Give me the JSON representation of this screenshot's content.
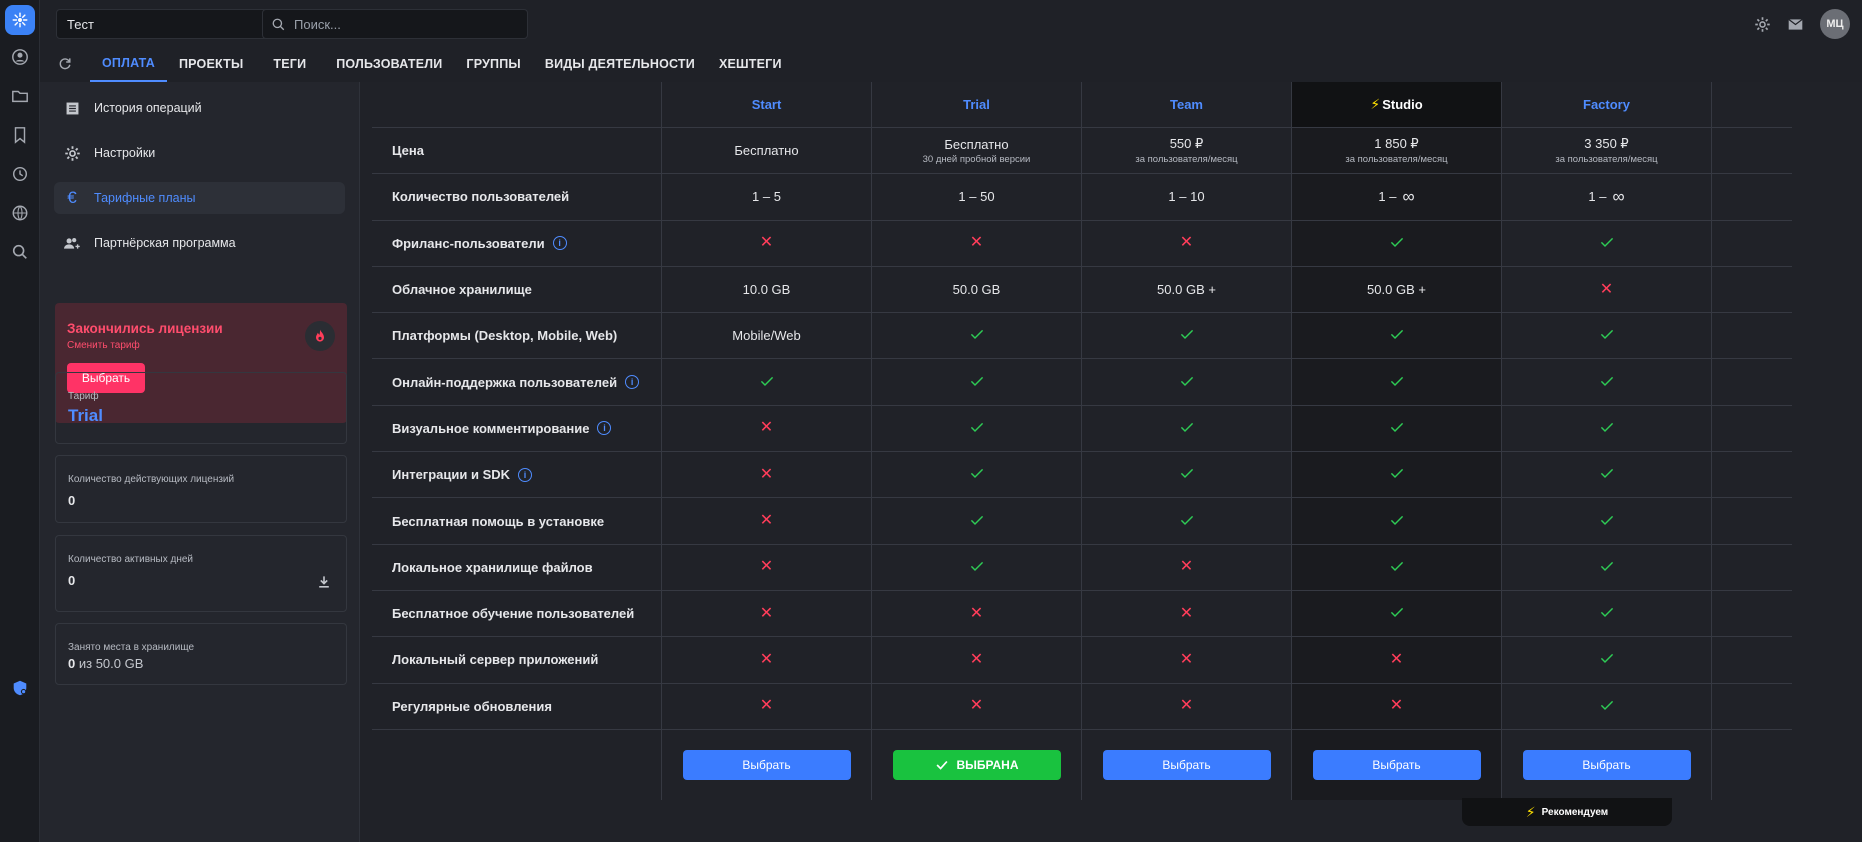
{
  "workspace": {
    "name": "Тест"
  },
  "search": {
    "placeholder": "Поиск..."
  },
  "user": {
    "initials": "МЦ"
  },
  "tabs": [
    "ОПЛАТА",
    "ПРОЕКТЫ",
    "ТЕГИ",
    "ПОЛЬЗОВАТЕЛИ",
    "ГРУППЫ",
    "ВИДЫ ДЕЯТЕЛЬНОСТИ",
    "ХЕШТЕГИ"
  ],
  "sidebar": {
    "items": [
      {
        "label": "История операций",
        "icon": "list-icon"
      },
      {
        "label": "Настройки",
        "icon": "gear-icon"
      },
      {
        "label": "Тарифные планы",
        "icon": "euro-icon"
      },
      {
        "label": "Партнёрская программа",
        "icon": "users-add-icon"
      }
    ],
    "alert": {
      "title": "Закончились лицензии",
      "subtitle": "Сменить тариф",
      "button": "Выбрать"
    },
    "plan": {
      "label": "Тариф",
      "value": "Trial"
    },
    "licenses": {
      "label": "Количество действующих лицензий",
      "value": "0"
    },
    "days": {
      "label": "Количество активных дней",
      "value": "0"
    },
    "storage": {
      "label": "Занято места в хранилище",
      "used": "0",
      "total": "из 50.0 GB"
    }
  },
  "plans": [
    {
      "name": "Start",
      "price": "Бесплатно",
      "price_sub": "",
      "users": "1 – 5",
      "storage": "10.0 GB",
      "platforms": "Mobile/Web",
      "button": "Выбрать",
      "selected": false
    },
    {
      "name": "Trial",
      "price": "Бесплатно",
      "price_sub": "30 дней пробной версии",
      "users": "1 – 50",
      "storage": "50.0 GB",
      "platforms": "",
      "button": "ВЫБРАНА",
      "selected": true
    },
    {
      "name": "Team",
      "price": "550 ₽",
      "price_sub": "за пользователя/месяц",
      "users": "1 – 10",
      "storage": "50.0 GB +",
      "platforms": "",
      "button": "Выбрать",
      "selected": false
    },
    {
      "name": "Studio",
      "price": "1 850 ₽",
      "price_sub": "за пользователя/месяц",
      "users": "1 –",
      "storage": "50.0 GB +",
      "platforms": "",
      "button": "Выбрать",
      "selected": false
    },
    {
      "name": "Factory",
      "price": "3 350 ₽",
      "price_sub": "за пользователя/месяц",
      "users": "1 –",
      "storage": "",
      "platforms": "",
      "button": "Выбрать",
      "selected": false
    }
  ],
  "features": {
    "price": "Цена",
    "users": "Количество пользователей",
    "freelance": "Фриланс-пользователи",
    "storage": "Облачное хранилище",
    "platforms": "Платформы (Desktop, Mobile, Web)",
    "online_support": "Онлайн-поддержка пользователей",
    "visual_comments": "Визуальное комментирование",
    "integrations": "Интеграции и SDK",
    "install_help": "Бесплатная помощь в установке",
    "local_storage": "Локальное хранилище файлов",
    "training": "Бесплатное обучение пользователей",
    "local_server": "Локальный сервер приложений",
    "updates": "Регулярные обновления"
  },
  "matrix": {
    "freelance": [
      false,
      false,
      false,
      true,
      true
    ],
    "storage_factory": false,
    "platforms": [
      null,
      true,
      true,
      true,
      true
    ],
    "online_support": [
      true,
      true,
      true,
      true,
      true
    ],
    "visual_comments": [
      false,
      true,
      true,
      true,
      true
    ],
    "integrations": [
      false,
      true,
      true,
      true,
      true
    ],
    "install_help": [
      false,
      true,
      true,
      true,
      true
    ],
    "local_storage": [
      false,
      true,
      false,
      true,
      true
    ],
    "training": [
      false,
      false,
      false,
      true,
      true
    ],
    "local_server": [
      false,
      false,
      false,
      false,
      true
    ],
    "updates": [
      false,
      false,
      false,
      false,
      true
    ]
  },
  "recommended": "Рекомендуем",
  "colors": {
    "accent": "#4f8cff",
    "danger": "#ff3d5a",
    "success": "#2ecc55",
    "selected": "#19c23f"
  }
}
